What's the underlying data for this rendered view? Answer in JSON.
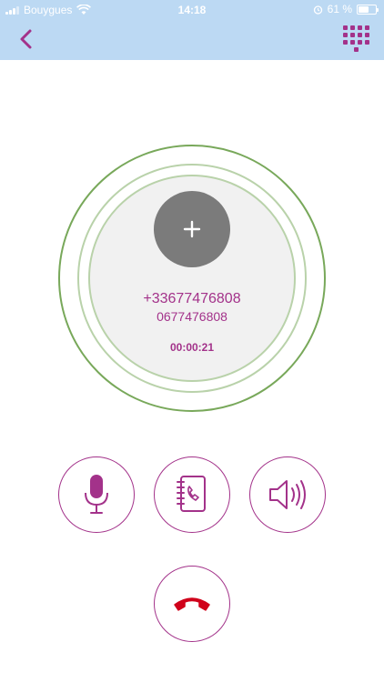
{
  "status_bar": {
    "carrier": "Bouygues",
    "time": "14:18",
    "battery_text": "61 %",
    "battery_level": 0.61
  },
  "nav": {
    "back_icon": "chevron-left-icon",
    "keypad_icon": "dialpad-icon",
    "accent_color": "#a3328a"
  },
  "call": {
    "add_icon": "plus-icon",
    "number_international": "+33677476808",
    "number_local": "0677476808",
    "duration": "00:00:21"
  },
  "actions": [
    {
      "name": "mute",
      "icon": "microphone-icon"
    },
    {
      "name": "contacts",
      "icon": "contacts-book-icon"
    },
    {
      "name": "speaker",
      "icon": "speaker-icon"
    },
    {
      "name": "hang-up",
      "icon": "hang-up-icon",
      "color": "#d0021b"
    }
  ],
  "colors": {
    "header_bg": "#bcd9f3",
    "ring_outer": "#78a85a",
    "ring_inner": "#b9d2aa",
    "circle_fill": "#f1f1f1",
    "add_button": "#7b7b7b"
  }
}
